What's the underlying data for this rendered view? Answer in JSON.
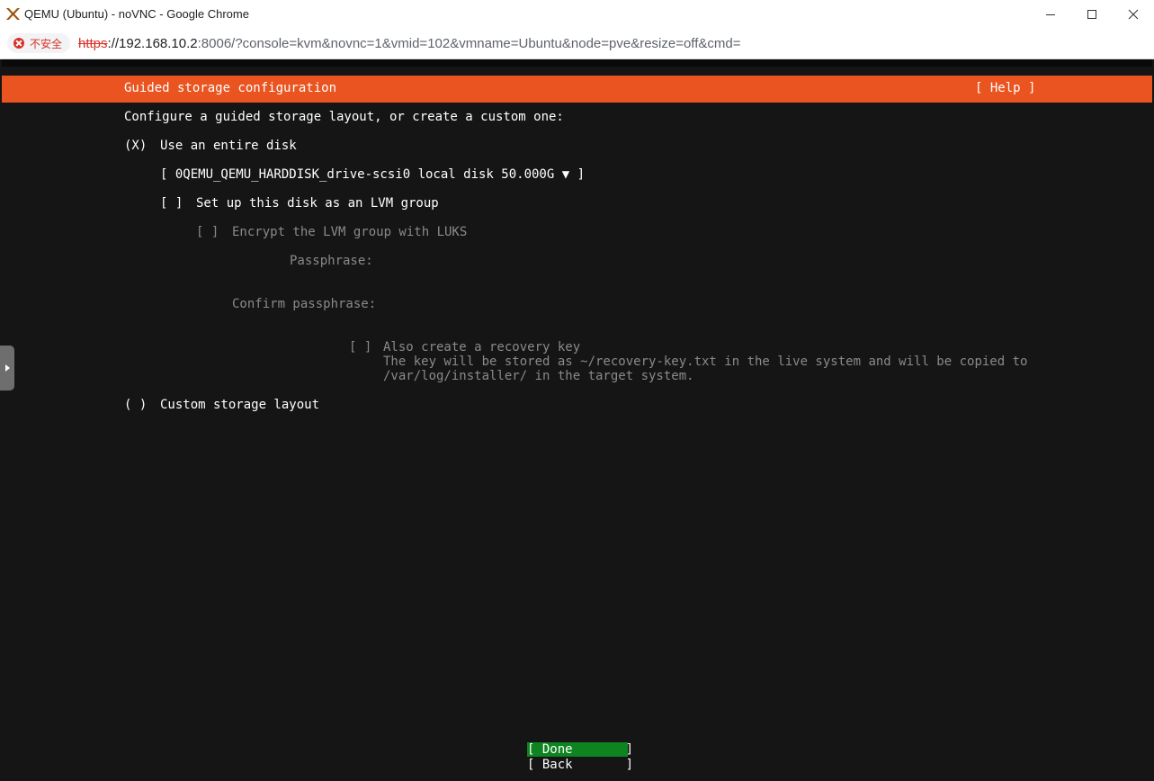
{
  "window": {
    "title": "QEMU (Ubuntu) - noVNC - Google Chrome",
    "icon": "proxmox-x-icon",
    "controls": [
      "minimize-icon",
      "maximize-icon",
      "close-icon"
    ]
  },
  "address_bar": {
    "security_label": "不安全",
    "url_scheme": "https",
    "url_host": "://192.168.10.2",
    "url_rest": ":8006/?console=kvm&novnc=1&vmid=102&vmname=Ubuntu&node=pve&resize=off&cmd="
  },
  "installer": {
    "header_title": "Guided storage configuration",
    "help_label": "[ Help ]",
    "intro": "Configure a guided storage layout, or create a custom one:",
    "entire_disk_radio": "(X)",
    "entire_disk_label": "Use an entire disk",
    "disk_select": "[ 0QEMU_QEMU_HARDDISK_drive-scsi0 local disk 50.000G ▼ ]",
    "lvm_checkbox": "[ ]",
    "lvm_label": "Set up this disk as an LVM group",
    "luks_checkbox": "[ ]",
    "luks_label": "Encrypt the LVM group with LUKS",
    "passphrase_label": "Passphrase:",
    "confirm_passphrase_label": "Confirm passphrase:",
    "recovery_checkbox": "[ ]",
    "recovery_label": "Also create a recovery key",
    "recovery_desc_1": "The key will be stored as ~/recovery-key.txt in the live system and will be copied to",
    "recovery_desc_2": "/var/log/installer/ in the target system.",
    "custom_radio": "( )",
    "custom_label": "Custom storage layout",
    "done_button": "[ Done       ]",
    "back_button": "[ Back       ]"
  },
  "colors": {
    "ubuntu_orange": "#e95420",
    "done_green": "#0e8420",
    "terminal_bg": "#151515"
  }
}
